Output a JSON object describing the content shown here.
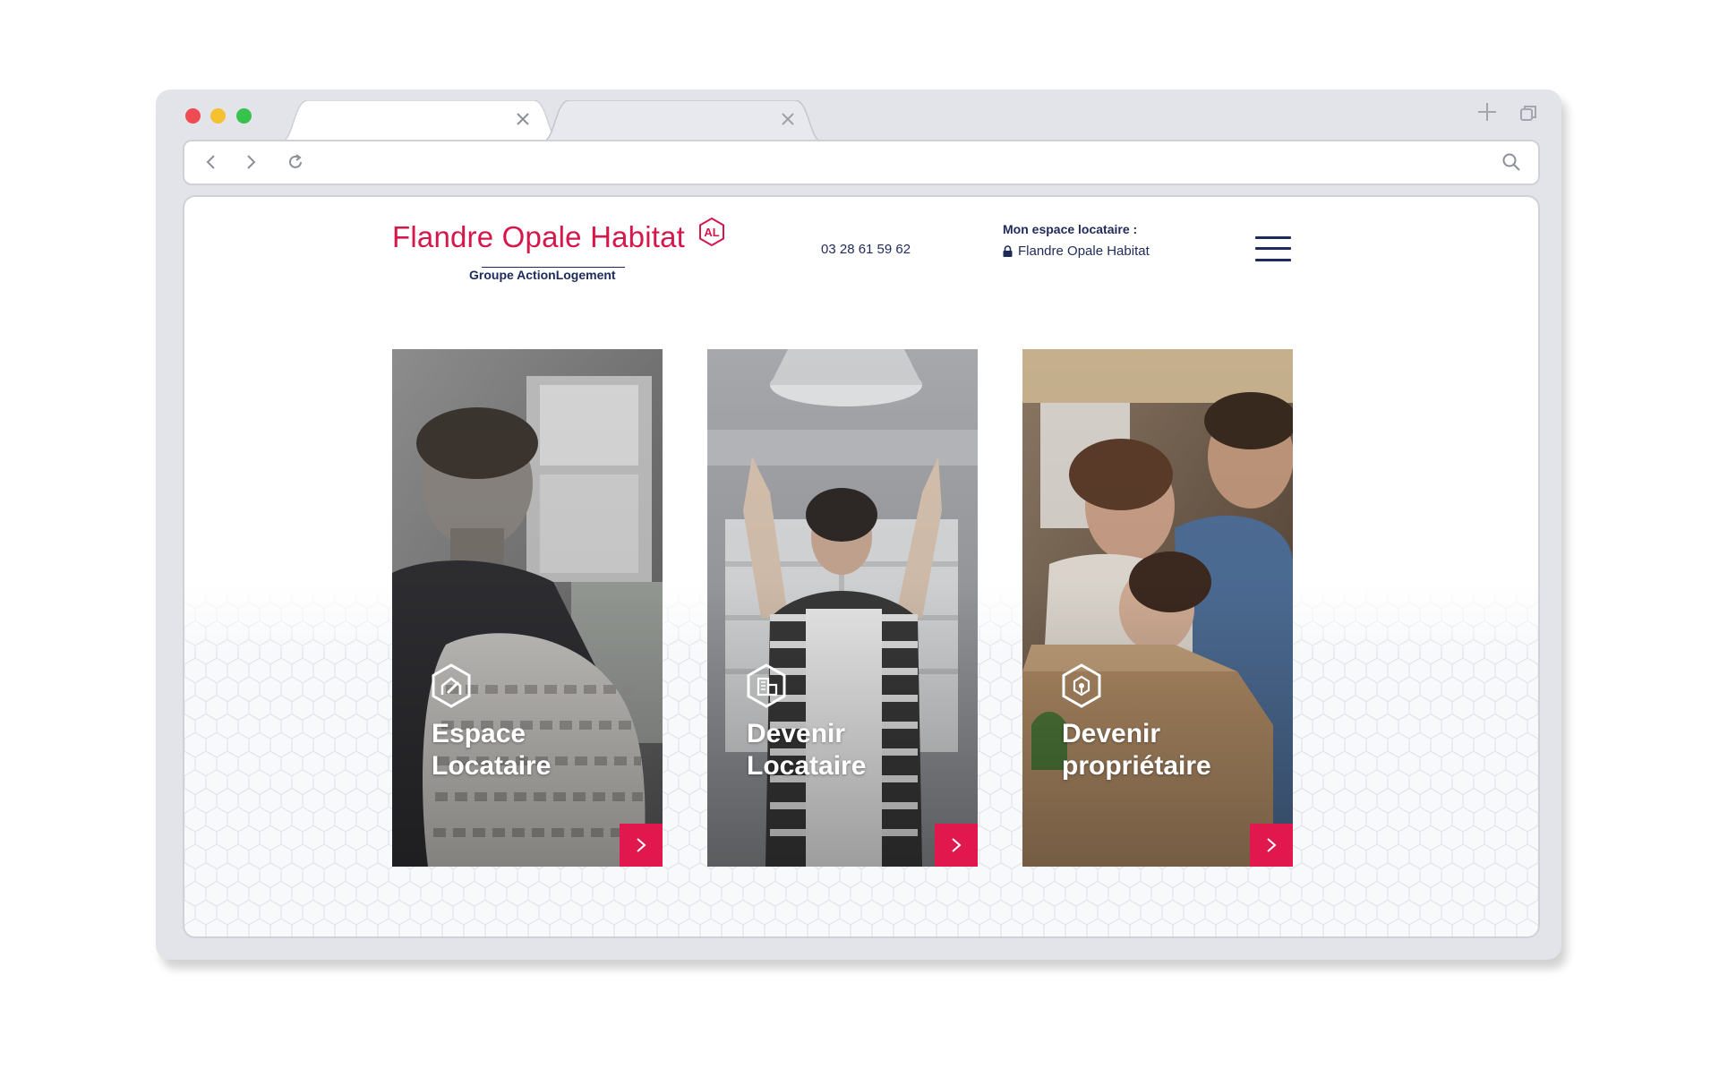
{
  "browser": {
    "tabs": [
      {
        "label": "",
        "active": true
      },
      {
        "label": "",
        "active": false
      }
    ],
    "address": ""
  },
  "header": {
    "logo_name": "Flandre Opale Habitat",
    "logo_badge": "AL",
    "logo_subtitle": "Groupe ActionLogement",
    "phone": "03 28 61 59 62",
    "espace_title": "Mon espace locataire :",
    "espace_link": "Flandre Opale Habitat"
  },
  "cards": [
    {
      "line1": "Espace",
      "line2": "Locataire",
      "icon": "house-pen-icon"
    },
    {
      "line1": "Devenir",
      "line2": "Locataire",
      "icon": "building-icon"
    },
    {
      "line1": "Devenir",
      "line2": "propriétaire",
      "icon": "house-key-icon"
    }
  ],
  "colors": {
    "brand_red": "#d5174b",
    "brand_navy": "#1e2a5a",
    "button_red": "#e1184d"
  }
}
